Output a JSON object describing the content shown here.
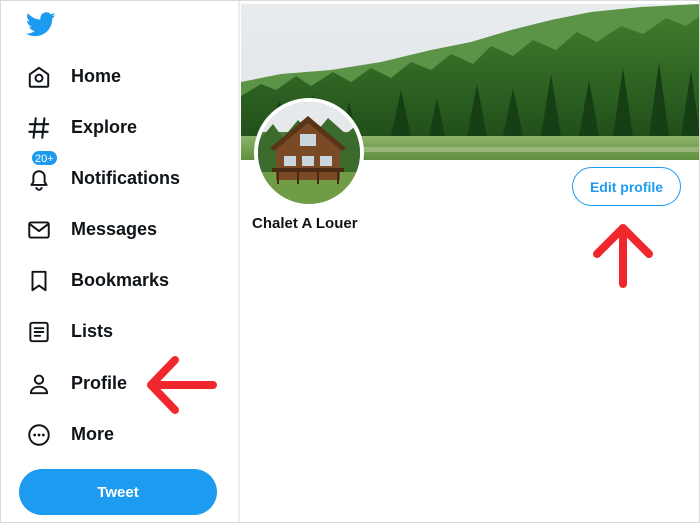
{
  "nav": {
    "items": [
      {
        "key": "home",
        "label": "Home",
        "icon": "home-icon"
      },
      {
        "key": "explore",
        "label": "Explore",
        "icon": "hashtag-icon"
      },
      {
        "key": "notifications",
        "label": "Notifications",
        "icon": "bell-icon"
      },
      {
        "key": "messages",
        "label": "Messages",
        "icon": "envelope-icon"
      },
      {
        "key": "bookmarks",
        "label": "Bookmarks",
        "icon": "bookmark-icon"
      },
      {
        "key": "lists",
        "label": "Lists",
        "icon": "list-icon"
      },
      {
        "key": "profile",
        "label": "Profile",
        "icon": "person-icon"
      },
      {
        "key": "more",
        "label": "More",
        "icon": "more-circle-icon"
      }
    ],
    "notifications_badge": "20+",
    "tweet_label": "Tweet"
  },
  "profile": {
    "name": "Chalet A Louer",
    "edit_label": "Edit profile"
  },
  "colors": {
    "accent": "#1d9bf0",
    "annotation_arrow": "#f0282d",
    "text": "#0f1419"
  },
  "logo": "twitter-bird-icon"
}
